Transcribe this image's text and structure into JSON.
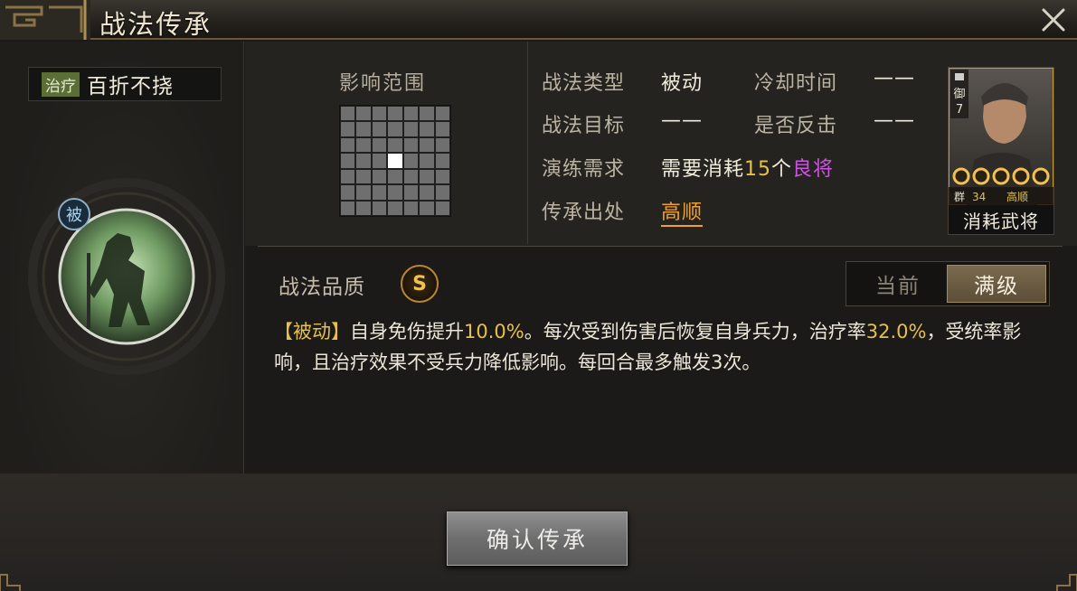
{
  "window": {
    "title": "战法传承",
    "close_icon": "close-icon"
  },
  "skill": {
    "tag": "治疗",
    "name": "百折不挠",
    "emblem_badge": "被"
  },
  "range": {
    "title": "影响范围",
    "grid_size": 7,
    "center_cell": [
      3,
      3
    ]
  },
  "attributes": {
    "type_label": "战法类型",
    "type_value": "被动",
    "cooldown_label": "冷却时间",
    "cooldown_value": "——",
    "target_label": "战法目标",
    "target_value": "——",
    "counter_label": "是否反击",
    "counter_value": "——",
    "training_label": "演练需求",
    "training_prefix": "需要消耗",
    "training_count": "15",
    "training_unit": "个",
    "training_item": "良将",
    "source_label": "传承出处",
    "source_value": "高顺"
  },
  "hero_card": {
    "type_char": "御",
    "cost": "7",
    "faction": "群",
    "level": "34",
    "name": "高顺",
    "stars": 5,
    "caption": "消耗武将"
  },
  "quality": {
    "label": "战法品质",
    "grade": "S"
  },
  "toggle": {
    "current": "当前",
    "max": "满级",
    "selected": "max"
  },
  "description": {
    "tag": "【被动】",
    "p1": "自身免伤提升",
    "v1": "10.0%",
    "p2": "。每次受到伤害后恢复自身兵力，治疗率",
    "v2": "32.0%",
    "p3": "，受统率影响，且治疗效果不受兵力降低影响。每回合最多触发3次。"
  },
  "footer": {
    "confirm_label": "确认传承"
  },
  "colors": {
    "highlight_yellow": "#e6c04a",
    "rarity_purple": "#cc54e0",
    "link_orange": "#f0a030",
    "quality_gold": "#b8862e"
  }
}
